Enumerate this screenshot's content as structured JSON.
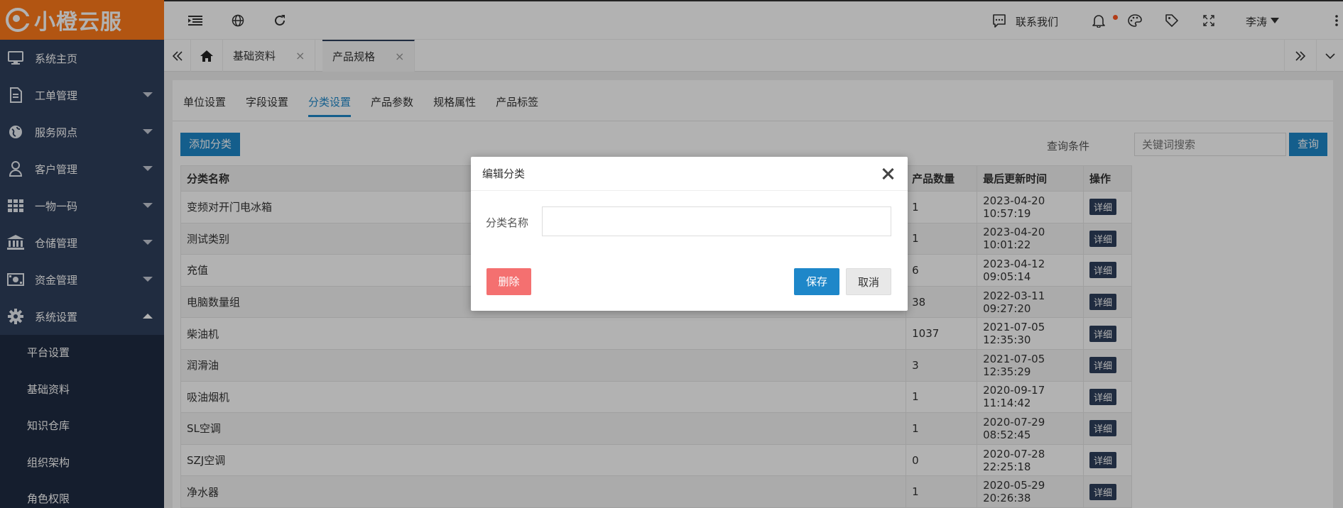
{
  "logo": {
    "text": "小橙云服"
  },
  "sidebar": {
    "items": [
      {
        "label": "系统主页",
        "icon": "monitor-icon"
      },
      {
        "label": "工单管理",
        "icon": "document-icon"
      },
      {
        "label": "服务网点",
        "icon": "globe-icon"
      },
      {
        "label": "客户管理",
        "icon": "user-icon"
      },
      {
        "label": "一物一码",
        "icon": "grid-icon"
      },
      {
        "label": "仓储管理",
        "icon": "bank-icon"
      },
      {
        "label": "资金管理",
        "icon": "money-icon"
      },
      {
        "label": "系统设置",
        "icon": "gear-icon"
      }
    ],
    "subitems": [
      "平台设置",
      "基础资料",
      "知识仓库",
      "组织架构",
      "角色权限"
    ]
  },
  "topbar": {
    "contact": "联系我们",
    "user": "李涛"
  },
  "tabbar": {
    "tabs": [
      "基础资料",
      "产品规格"
    ],
    "close": "×"
  },
  "subtabs": [
    "单位设置",
    "字段设置",
    "分类设置",
    "产品参数",
    "规格属性",
    "产品标签"
  ],
  "toolbar": {
    "add": "添加分类",
    "query_label": "查询条件",
    "search_placeholder": "关键词搜索",
    "search": "查询"
  },
  "table": {
    "headers": [
      "分类名称",
      "产品数量",
      "最后更新时间",
      "操作"
    ],
    "detail_label": "详细",
    "rows": [
      {
        "name": "变频对开门电冰箱",
        "count": "1",
        "time": "2023-04-20 10:57:19"
      },
      {
        "name": "测试类别",
        "count": "1",
        "time": "2023-04-20 10:01:22"
      },
      {
        "name": "充值",
        "count": "6",
        "time": "2023-04-12 09:05:14"
      },
      {
        "name": "电脑数量组",
        "count": "38",
        "time": "2022-03-11 09:27:20"
      },
      {
        "name": "柴油机",
        "count": "1037",
        "time": "2021-07-05 12:35:30"
      },
      {
        "name": "润滑油",
        "count": "3",
        "time": "2021-07-05 12:35:29"
      },
      {
        "name": "吸油烟机",
        "count": "1",
        "time": "2020-09-17 11:14:42"
      },
      {
        "name": "SL空调",
        "count": "1",
        "time": "2020-07-29 08:52:45"
      },
      {
        "name": "SZJ空调",
        "count": "0",
        "time": "2020-07-28 22:25:18"
      },
      {
        "name": "净水器",
        "count": "1",
        "time": "2020-05-29 20:26:38"
      }
    ]
  },
  "modal": {
    "title": "编辑分类",
    "field_label": "分类名称",
    "field_value": "",
    "delete": "删除",
    "save": "保存",
    "cancel": "取消"
  },
  "colors": {
    "brand": "#ff7a1a",
    "sidebar": "#2f3f5c",
    "primary": "#1e87c9",
    "danger": "#f47070"
  }
}
